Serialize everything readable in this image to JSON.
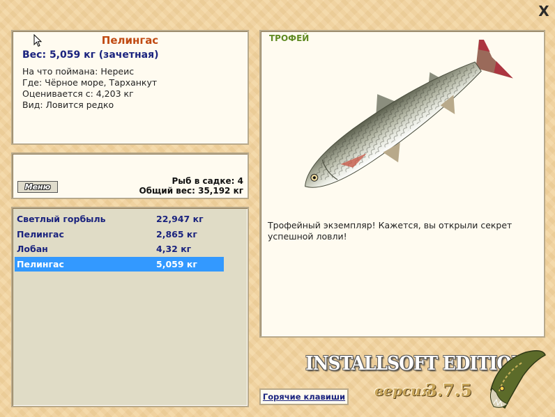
{
  "window": {
    "close_symbol": "X"
  },
  "fish_info": {
    "title": "Пелингас",
    "weight_line": "Вес: 5,059 кг (зачетная)",
    "bait_line": "На что поймана: Нереис",
    "location_line": "Где: Чёрное море, Тарханкут",
    "value_line": "Оценивается с: 4,203 кг",
    "rarity_line": "Вид: Ловится редко"
  },
  "keepnet": {
    "menu_label": "Меню",
    "fish_count": "Рыб в садке: 4",
    "total_weight": "Общий вес: 35,192 кг"
  },
  "catch_list": [
    {
      "name": "Светлый горбыль",
      "weight": "22,947 кг"
    },
    {
      "name": "Пелингас",
      "weight": "2,865 кг"
    },
    {
      "name": "Лобан",
      "weight": "4,32 кг"
    },
    {
      "name": "Пелингас",
      "weight": "5,059 кг"
    }
  ],
  "selected_index": 3,
  "trophy": {
    "label": "ТРОФЕЙ",
    "message": "Трофейный экземпляр! Кажется, вы открыли секрет успешной ловли!"
  },
  "footer": {
    "hotkeys_label": "Горячие клавиши",
    "brand": "INSTALLSOFT EDITION",
    "version_word": "версия",
    "version_number": "3.7.5"
  },
  "icons": {
    "close": "close-icon",
    "cursor": "mouse-cursor-icon",
    "fish": "fish-image",
    "logo": "pike-logo-icon"
  },
  "colors": {
    "title": "#c04a12",
    "list_text": "#1a237e",
    "selection": "#3399ff",
    "trophy_label": "#5f8a22"
  }
}
